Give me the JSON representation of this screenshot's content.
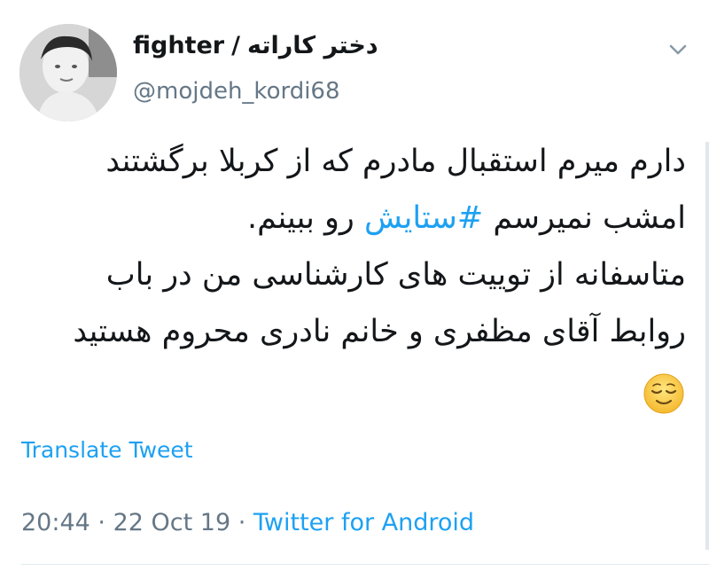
{
  "user": {
    "display_name_fa": "دختر کاراته",
    "separator": "/",
    "display_name_en": "fighter",
    "handle": "@mojdeh_kordi68"
  },
  "tweet": {
    "line1": "دارم میرم استقبال مادرم که از کربلا برگشتند",
    "line2_prefix": "امشب نمیرسم",
    "hashtag": "#ستایش",
    "line2_suffix": "رو ببینم.",
    "line3": "متاسفانه از توییت های کارشناسی من در باب",
    "line4": "روابط آقای مظفری و خانم نادری محروم هستید"
  },
  "translate_label": "Translate Tweet",
  "meta": {
    "time": "20:44",
    "dot1": " · ",
    "date": "22 Oct 19",
    "dot2": " · ",
    "source": "Twitter for Android"
  },
  "icons": {
    "menu": "chevron-down-icon",
    "emoji": "relieved-face-emoji"
  },
  "colors": {
    "link": "#1da1f2",
    "secondary": "#657786",
    "text": "#14171a"
  }
}
